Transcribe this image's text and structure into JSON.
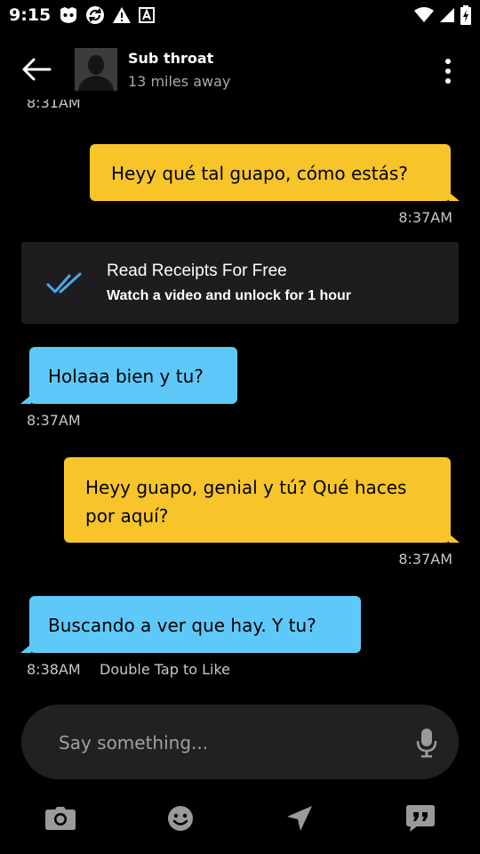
{
  "status_bar": {
    "time": "9:15",
    "notification_icons": [
      "gamepad-icon",
      "sync-icon",
      "warning-icon",
      "font-icon"
    ],
    "right_icons": [
      "wifi-icon",
      "signal-icon",
      "battery-icon"
    ]
  },
  "header": {
    "name": "Sub throat",
    "distance": "13 miles away"
  },
  "cut_timestamp": "8:31AM",
  "messages": [
    {
      "direction": "outgoing",
      "text": "Heyy qué tal guapo, cómo estás?",
      "time": "8:37AM"
    },
    {
      "direction": "incoming",
      "text": "Holaaa bien y tu?",
      "time": "8:37AM"
    },
    {
      "direction": "outgoing",
      "text": "Heyy guapo, genial y tú? Qué haces por aquí?",
      "time": "8:37AM"
    },
    {
      "direction": "incoming",
      "text": "Buscando a ver que hay. Y tu?",
      "time": "8:38AM",
      "hint": "Double Tap to Like"
    }
  ],
  "read_receipts": {
    "title": "Read Receipts For Free",
    "subtitle": "Watch a video and unlock for 1 hour"
  },
  "composer": {
    "placeholder": "Say something..."
  },
  "toolbar_icons": [
    "camera-icon",
    "smiley-icon",
    "location-arrow-icon",
    "quote-bubble-icon"
  ],
  "colors": {
    "outgoing_bubble": "#f7c52a",
    "incoming_bubble": "#5ec9f8",
    "receipt_check": "#4aa8e6",
    "background": "#000000"
  }
}
